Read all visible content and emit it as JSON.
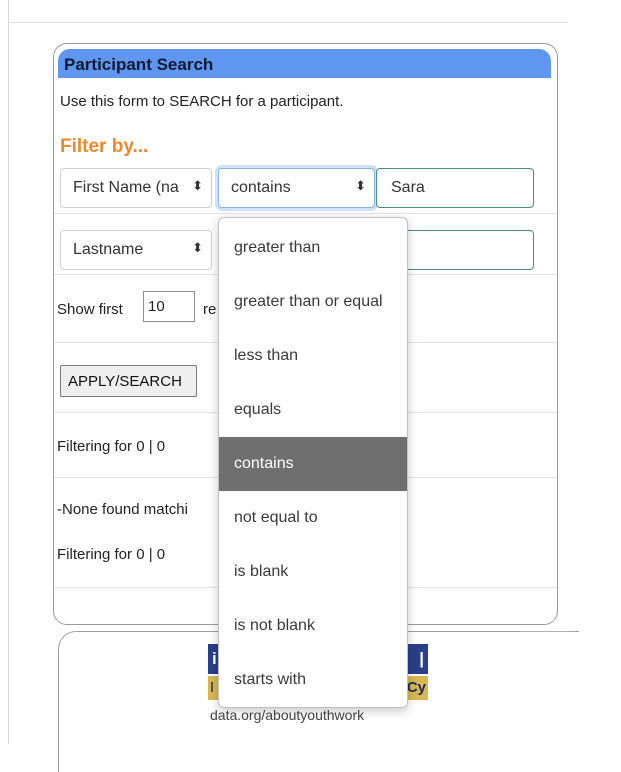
{
  "panel": {
    "title": "Participant Search",
    "intro": "Use this form to SEARCH for a participant.",
    "filter_heading": "Filter by...",
    "filters": [
      {
        "field": "First Name (na",
        "operator": "contains",
        "value": "Sara"
      },
      {
        "field": "Lastname",
        "operator": "",
        "value": ""
      }
    ],
    "show_first_label": "Show first",
    "show_first_value": "10",
    "show_first_suffix": "re",
    "apply_button": "APPLY/SEARCH",
    "filtering_text_1": "Filtering for 0 | 0",
    "none_found_text": "-None found matchi",
    "filtering_text_2": "Filtering for 0 | 0"
  },
  "footer": {
    "frag_dark_left": "i",
    "frag_dark_right": "|",
    "frag_gold_left": "I",
    "frag_gold_right": "Cy",
    "link": "data.org/aboutyouthwork"
  },
  "dropdown": {
    "options": [
      "greater than",
      "greater than or equal",
      "less than",
      "equals",
      "contains",
      "not equal to",
      "is blank",
      "is not blank",
      "starts with"
    ],
    "selected_index": 4
  },
  "icons": {
    "select_caret": "updown-caret-icon"
  },
  "colors": {
    "header_bg": "#5e96f0",
    "filter_heading": "#ec8a2a",
    "input_border": "#4b8f80",
    "selected_option_bg": "#6f6f6f"
  }
}
